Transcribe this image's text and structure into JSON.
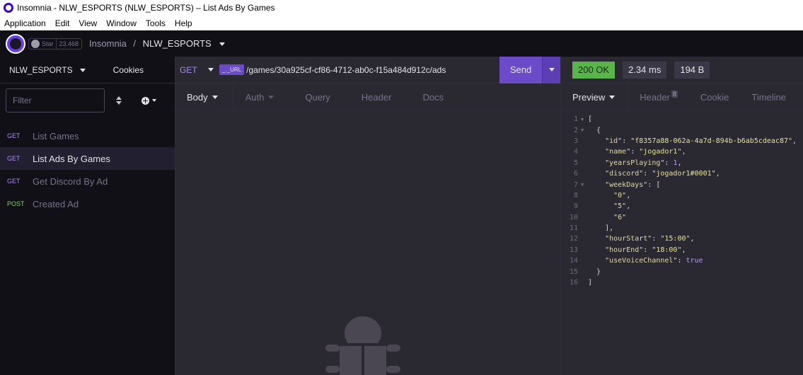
{
  "window": {
    "title": "Insomnia - NLW_ESPORTS (NLW_ESPORTS) – List Ads By Games",
    "menu": [
      "Application",
      "Edit",
      "View",
      "Window",
      "Tools",
      "Help"
    ]
  },
  "header": {
    "star_label": "Star",
    "star_count": "23.468",
    "crumb_app": "Insomnia",
    "crumb_sep": "/",
    "crumb_project": "NLW_ESPORTS"
  },
  "sidebar": {
    "workspace": "NLW_ESPORTS",
    "cookies_label": "Cookies",
    "filter_placeholder": "Filter",
    "requests": [
      {
        "method": "GET",
        "name": "List Games"
      },
      {
        "method": "GET",
        "name": "List Ads By Games"
      },
      {
        "method": "GET",
        "name": "Get Discord By Ad"
      },
      {
        "method": "POST",
        "name": "Created Ad"
      }
    ]
  },
  "request": {
    "method": "GET",
    "env_tag": "_._URL",
    "url_path": "/games/30a925cf-cf86-4712-ab0c-f15a484d912c/ads",
    "send_label": "Send",
    "tabs": [
      "Body",
      "Auth",
      "Query",
      "Header",
      "Docs"
    ]
  },
  "response": {
    "status": "200 OK",
    "time": "2.34 ms",
    "size": "194 B",
    "status_color": "#57b54a",
    "tabs": [
      "Preview",
      "Header",
      "Cookie",
      "Timeline"
    ],
    "header_count": "8",
    "lines": [
      {
        "no": "1",
        "fold": true
      },
      {
        "no": "2",
        "fold": true
      },
      {
        "no": "3"
      },
      {
        "no": "4"
      },
      {
        "no": "5"
      },
      {
        "no": "6"
      },
      {
        "no": "7",
        "fold": true
      },
      {
        "no": "8"
      },
      {
        "no": "9"
      },
      {
        "no": "10"
      },
      {
        "no": "11"
      },
      {
        "no": "12"
      },
      {
        "no": "13"
      },
      {
        "no": "14"
      },
      {
        "no": "15"
      },
      {
        "no": "16"
      }
    ],
    "json": {
      "id_key": "\"id\"",
      "id_val": "\"f8357a88-062a-4a7d-894b-b6ab5cdeac87\"",
      "name_key": "\"name\"",
      "name_val": "\"jogador1\"",
      "years_key": "\"yearsPlaying\"",
      "years_val": "1",
      "discord_key": "\"discord\"",
      "discord_val": "\"jogador1#0001\"",
      "weekdays_key": "\"weekDays\"",
      "wd0": "\"0\"",
      "wd1": "\"5\"",
      "wd2": "\"6\"",
      "hs_key": "\"hourStart\"",
      "hs_val": "\"15:00\"",
      "he_key": "\"hourEnd\"",
      "he_val": "\"18:00\"",
      "vc_key": "\"useVoiceChannel\"",
      "vc_val": "true"
    }
  }
}
